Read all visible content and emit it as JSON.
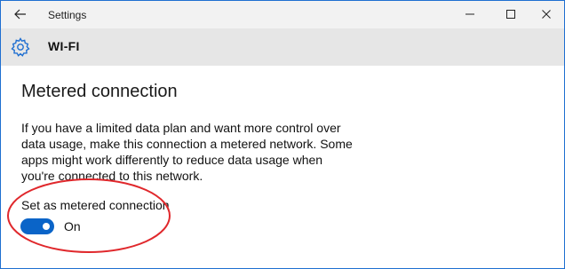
{
  "window": {
    "title": "Settings",
    "controls": {
      "back": "arrow-left-icon",
      "minimize": "minimize-icon",
      "maximize": "maximize-icon",
      "close": "close-icon"
    }
  },
  "header": {
    "icon": "gear-icon",
    "title": "WI-FI"
  },
  "main": {
    "page_title": "Metered connection",
    "description": "If you have a limited data plan and want more control over data usage, make this connection a metered network. Some apps might work differently to reduce data usage when you're connected to this network.",
    "toggle": {
      "label": "Set as metered connection",
      "state_label": "On",
      "on": true,
      "accent_color": "#0a64c8"
    },
    "annotation_color": "#e0282c"
  }
}
